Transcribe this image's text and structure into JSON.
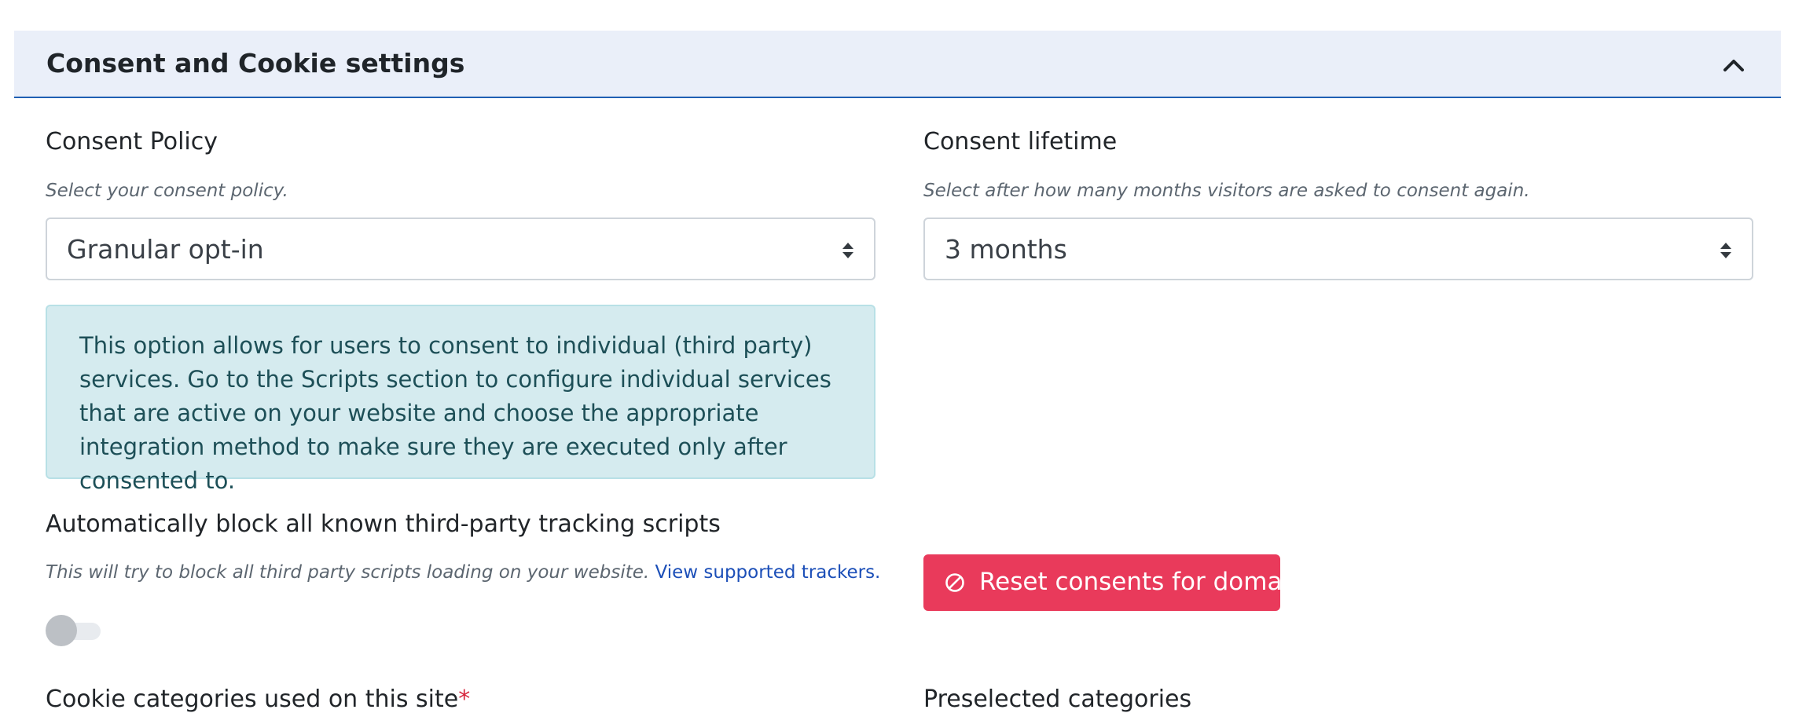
{
  "panel": {
    "title": "Consent and Cookie settings"
  },
  "consent_policy": {
    "label": "Consent Policy",
    "help": "Select your consent policy.",
    "selected": "Granular opt-in",
    "info": "This option allows for users to consent to individual (third party) services. Go to the Scripts section to configure individual services that are active on your website and choose the appropriate integration method to make sure they are executed only after consented to."
  },
  "consent_lifetime": {
    "label": "Consent lifetime",
    "help": "Select after how many months visitors are asked to consent again.",
    "selected": "3 months"
  },
  "auto_block": {
    "label": "Automatically block all known third-party tracking scripts",
    "help": "This will try to block all third party scripts loading on your website.",
    "link": "View supported trackers.",
    "enabled": false
  },
  "reset_button": {
    "label": "Reset consents for domain"
  },
  "cookie_categories": {
    "label": "Cookie categories used on this site",
    "required_marker": "*"
  },
  "preselected": {
    "label": "Preselected categories"
  },
  "colors": {
    "header_bg": "#eaeff9",
    "header_border": "#1f5fb3",
    "info_bg": "#d5ebef",
    "danger": "#e93a5b",
    "link": "#1c4fb8"
  },
  "icons": {
    "collapse": "chevron-up-icon",
    "select_caret": "sort-caret-icon",
    "reset": "ban-icon"
  }
}
